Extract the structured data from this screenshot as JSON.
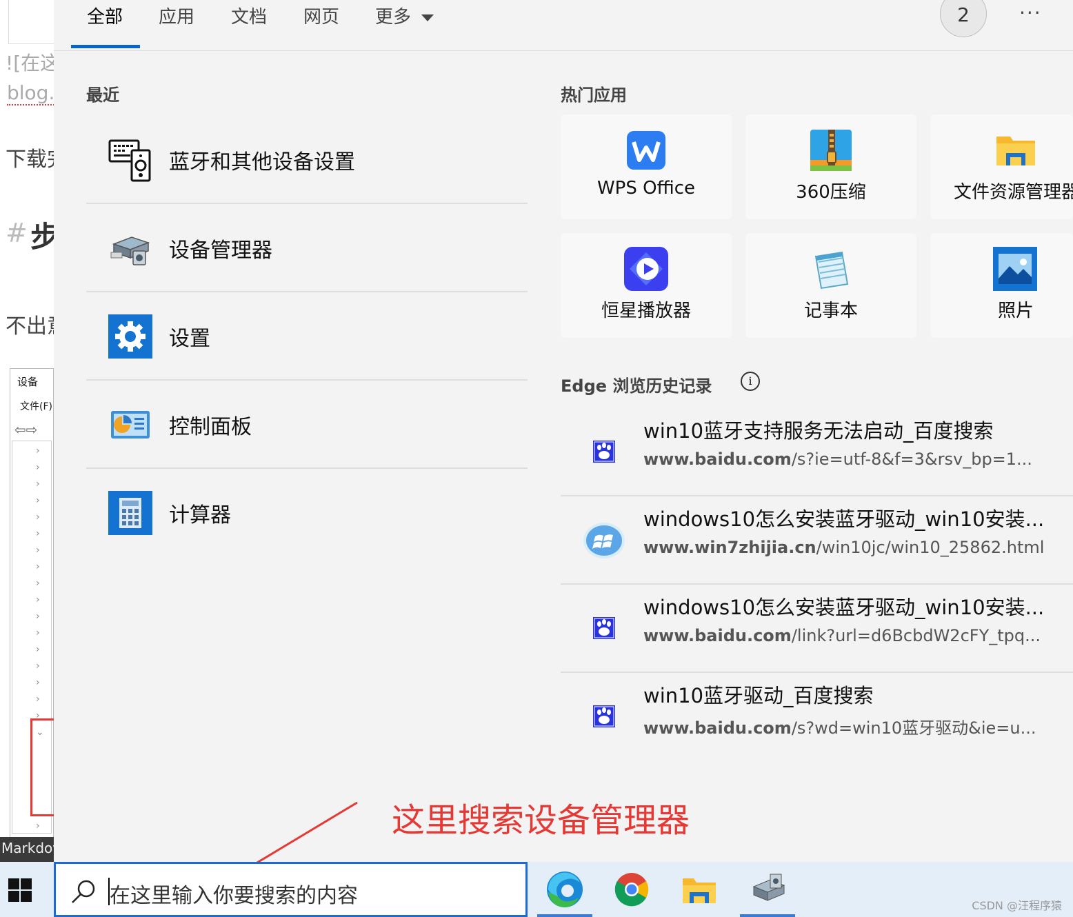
{
  "background": {
    "link_text": "![在这",
    "link_text2": "blog.c",
    "para1": "下载完",
    "heading_hash": "#",
    "heading_text": "步",
    "para2": "不出意",
    "devmgr_title": "设备",
    "devmgr_menu": "文件(F)",
    "markdown_label": "Markdov"
  },
  "tabs": [
    {
      "label": "全部",
      "active": true
    },
    {
      "label": "应用"
    },
    {
      "label": "文档"
    },
    {
      "label": "网页"
    },
    {
      "label": "更多"
    }
  ],
  "badge_count": "2",
  "more_dots": "···",
  "recent": {
    "title": "最近",
    "items": [
      {
        "label": "蓝牙和其他设备设置",
        "icon": "bluetooth-devices-icon"
      },
      {
        "label": "设备管理器",
        "icon": "device-manager-icon"
      },
      {
        "label": "设置",
        "icon": "settings-gear-icon"
      },
      {
        "label": "控制面板",
        "icon": "control-panel-icon"
      },
      {
        "label": "计算器",
        "icon": "calculator-icon"
      }
    ]
  },
  "hot_apps": {
    "title": "热门应用",
    "items": [
      {
        "label": "WPS Office",
        "icon": "wps-office-icon"
      },
      {
        "label": "360压缩",
        "icon": "360-zip-icon"
      },
      {
        "label": "文件资源管理器",
        "icon": "file-explorer-icon"
      },
      {
        "label": "恒星播放器",
        "icon": "stellar-player-icon"
      },
      {
        "label": "记事本",
        "icon": "notepad-icon"
      },
      {
        "label": "照片",
        "icon": "photos-icon"
      }
    ]
  },
  "history": {
    "title": "Edge 浏览历史记录",
    "items": [
      {
        "title": "win10蓝牙支持服务无法启动_百度搜索",
        "domain": "www.baidu.com",
        "path": "/s?ie=utf-8&f=3&rsv_bp=1...",
        "icon": "baidu-icon"
      },
      {
        "title": "windows10怎么安装蓝牙驱动_win10安装...",
        "domain": "www.win7zhijia.cn",
        "path": "/win10jc/win10_25862.html",
        "icon": "windows-logo-icon"
      },
      {
        "title": "windows10怎么安装蓝牙驱动_win10安装...",
        "domain": "www.baidu.com",
        "path": "/link?url=d6BcbdW2cFY_tpq...",
        "icon": "baidu-icon"
      },
      {
        "title": "win10蓝牙驱动_百度搜索",
        "domain": "www.baidu.com",
        "path": "/s?wd=win10蓝牙驱动&ie=u...",
        "icon": "baidu-icon"
      }
    ]
  },
  "annotation": "这里搜索设备管理器",
  "search": {
    "placeholder": "在这里输入你要搜索的内容"
  },
  "watermark": "CSDN @汪程序猿",
  "colors": {
    "accent": "#0a64c8",
    "annotation_red": "#e53935"
  }
}
